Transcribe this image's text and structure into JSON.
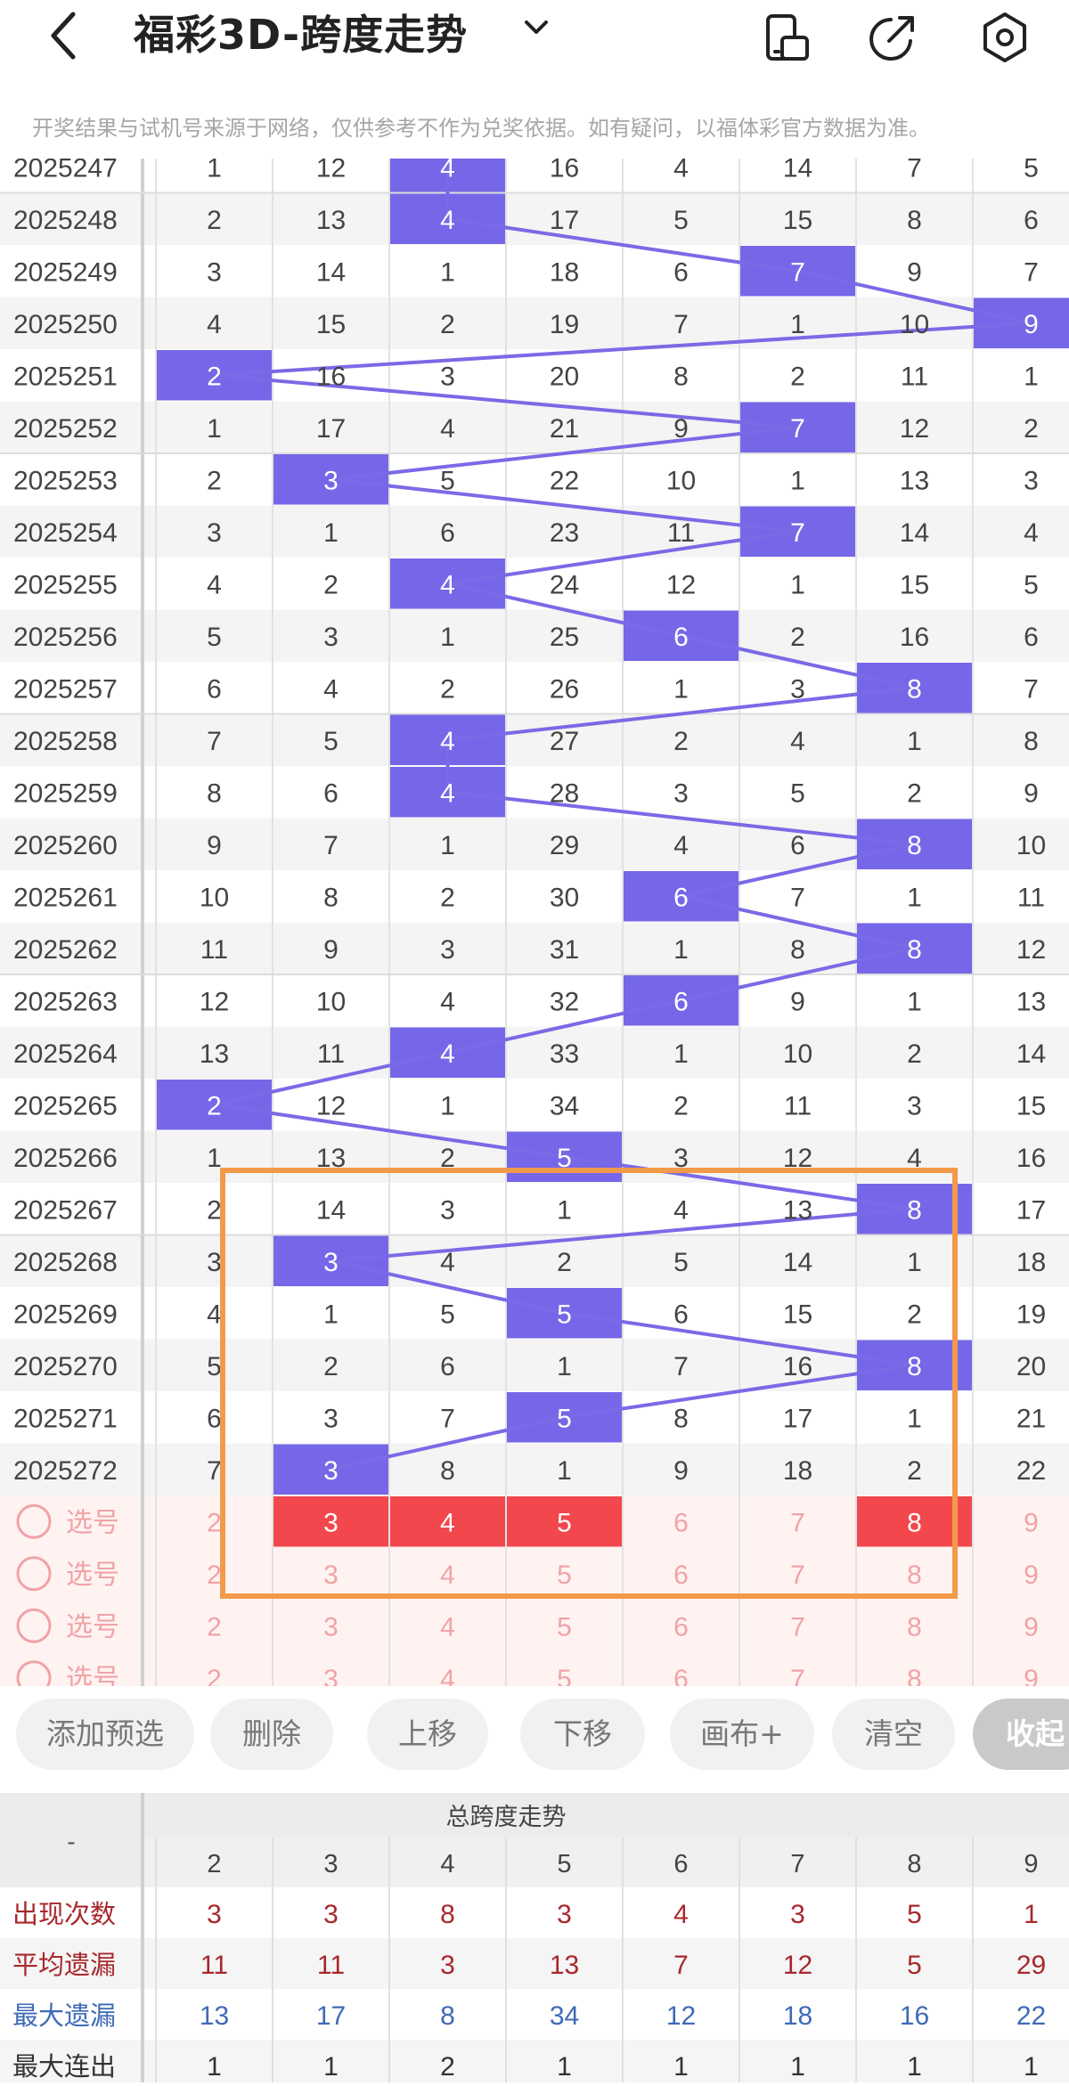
{
  "header": {
    "back_icon": "chevron-left-icon",
    "title": "福彩3D-跨度走势",
    "dropdown_icon": "chevron-down-icon",
    "icons": [
      "phone-rotate-icon",
      "share-icon",
      "settings-icon"
    ]
  },
  "notice": "开奖结果与试机号来源于网络，仅供参考不作为兑奖依据。如有疑问，以福体彩官方数据为准。",
  "columns": [
    "2",
    "3",
    "4",
    "5",
    "6",
    "7",
    "8",
    "9"
  ],
  "rows": [
    {
      "issue": "2025247",
      "values": [
        "1",
        "12",
        "4",
        "16",
        "4",
        "14",
        "7",
        "5"
      ],
      "hit": 2
    },
    {
      "issue": "2025248",
      "values": [
        "2",
        "13",
        "4",
        "17",
        "5",
        "15",
        "8",
        "6"
      ],
      "hit": 2
    },
    {
      "issue": "2025249",
      "values": [
        "3",
        "14",
        "1",
        "18",
        "6",
        "7",
        "9",
        "7"
      ],
      "hit": 5
    },
    {
      "issue": "2025250",
      "values": [
        "4",
        "15",
        "2",
        "19",
        "7",
        "1",
        "10",
        "9"
      ],
      "hit": 7
    },
    {
      "issue": "2025251",
      "values": [
        "2",
        "16",
        "3",
        "20",
        "8",
        "2",
        "11",
        "1"
      ],
      "hit": 0
    },
    {
      "issue": "2025252",
      "values": [
        "1",
        "17",
        "4",
        "21",
        "9",
        "7",
        "12",
        "2"
      ],
      "hit": 5
    },
    {
      "issue": "2025253",
      "values": [
        "2",
        "3",
        "5",
        "22",
        "10",
        "1",
        "13",
        "3"
      ],
      "hit": 1
    },
    {
      "issue": "2025254",
      "values": [
        "3",
        "1",
        "6",
        "23",
        "11",
        "7",
        "14",
        "4"
      ],
      "hit": 5
    },
    {
      "issue": "2025255",
      "values": [
        "4",
        "2",
        "4",
        "24",
        "12",
        "1",
        "15",
        "5"
      ],
      "hit": 2
    },
    {
      "issue": "2025256",
      "values": [
        "5",
        "3",
        "1",
        "25",
        "6",
        "2",
        "16",
        "6"
      ],
      "hit": 4
    },
    {
      "issue": "2025257",
      "values": [
        "6",
        "4",
        "2",
        "26",
        "1",
        "3",
        "8",
        "7"
      ],
      "hit": 6
    },
    {
      "issue": "2025258",
      "values": [
        "7",
        "5",
        "4",
        "27",
        "2",
        "4",
        "1",
        "8"
      ],
      "hit": 2
    },
    {
      "issue": "2025259",
      "values": [
        "8",
        "6",
        "4",
        "28",
        "3",
        "5",
        "2",
        "9"
      ],
      "hit": 2
    },
    {
      "issue": "2025260",
      "values": [
        "9",
        "7",
        "1",
        "29",
        "4",
        "6",
        "8",
        "10"
      ],
      "hit": 6
    },
    {
      "issue": "2025261",
      "values": [
        "10",
        "8",
        "2",
        "30",
        "6",
        "7",
        "1",
        "11"
      ],
      "hit": 4
    },
    {
      "issue": "2025262",
      "values": [
        "11",
        "9",
        "3",
        "31",
        "1",
        "8",
        "8",
        "12"
      ],
      "hit": 6
    },
    {
      "issue": "2025263",
      "values": [
        "12",
        "10",
        "4",
        "32",
        "6",
        "9",
        "1",
        "13"
      ],
      "hit": 4
    },
    {
      "issue": "2025264",
      "values": [
        "13",
        "11",
        "4",
        "33",
        "1",
        "10",
        "2",
        "14"
      ],
      "hit": 2
    },
    {
      "issue": "2025265",
      "values": [
        "2",
        "12",
        "1",
        "34",
        "2",
        "11",
        "3",
        "15"
      ],
      "hit": 0
    },
    {
      "issue": "2025266",
      "values": [
        "1",
        "13",
        "2",
        "5",
        "3",
        "12",
        "4",
        "16"
      ],
      "hit": 3
    },
    {
      "issue": "2025267",
      "values": [
        "2",
        "14",
        "3",
        "1",
        "4",
        "13",
        "8",
        "17"
      ],
      "hit": 6
    },
    {
      "issue": "2025268",
      "values": [
        "3",
        "3",
        "4",
        "2",
        "5",
        "14",
        "1",
        "18"
      ],
      "hit": 1
    },
    {
      "issue": "2025269",
      "values": [
        "4",
        "1",
        "5",
        "5",
        "6",
        "15",
        "2",
        "19"
      ],
      "hit": 3
    },
    {
      "issue": "2025270",
      "values": [
        "5",
        "2",
        "6",
        "1",
        "7",
        "16",
        "8",
        "20"
      ],
      "hit": 6
    },
    {
      "issue": "2025271",
      "values": [
        "6",
        "3",
        "7",
        "5",
        "8",
        "17",
        "1",
        "21"
      ],
      "hit": 3
    },
    {
      "issue": "2025272",
      "values": [
        "7",
        "3",
        "8",
        "1",
        "9",
        "18",
        "2",
        "22"
      ],
      "hit": 1
    }
  ],
  "pick_rows": [
    {
      "label": "选号",
      "values": [
        "2",
        "3",
        "4",
        "5",
        "6",
        "7",
        "8",
        "9"
      ],
      "selected": [
        1,
        2,
        3,
        6
      ]
    },
    {
      "label": "选号",
      "values": [
        "2",
        "3",
        "4",
        "5",
        "6",
        "7",
        "8",
        "9"
      ],
      "selected": []
    },
    {
      "label": "选号",
      "values": [
        "2",
        "3",
        "4",
        "5",
        "6",
        "7",
        "8",
        "9"
      ],
      "selected": []
    },
    {
      "label": "选号",
      "values": [
        "2",
        "3",
        "4",
        "5",
        "6",
        "7",
        "8",
        "9"
      ],
      "selected": []
    }
  ],
  "actions": {
    "add": "添加预选",
    "delete": "删除",
    "move_up": "上移",
    "move_down": "下移",
    "canvas": "画布+",
    "clear": "清空",
    "collapse": "收起"
  },
  "stats": {
    "corner": "-",
    "title": "总跨度走势",
    "columns": [
      "2",
      "3",
      "4",
      "5",
      "6",
      "7",
      "8",
      "9"
    ],
    "rows": [
      {
        "label": "出现次数",
        "values": [
          "3",
          "3",
          "8",
          "3",
          "4",
          "3",
          "5",
          "1"
        ]
      },
      {
        "label": "平均遗漏",
        "values": [
          "11",
          "11",
          "3",
          "13",
          "7",
          "12",
          "5",
          "29"
        ]
      },
      {
        "label": "最大遗漏",
        "values": [
          "13",
          "17",
          "8",
          "34",
          "12",
          "18",
          "16",
          "22"
        ]
      },
      {
        "label": "最大连出",
        "values": [
          "1",
          "1",
          "2",
          "1",
          "1",
          "1",
          "1",
          "1"
        ]
      }
    ]
  },
  "colors": {
    "hit": "#7567e8",
    "line": "#7a6ae6",
    "selected": "#f2474d",
    "pick_text": "#f0a3a6",
    "pick_bg": "#fff3f1",
    "highlight_box": "#f39a4a",
    "stat_red": "#a8282d",
    "stat_blue": "#3f6ab8"
  }
}
